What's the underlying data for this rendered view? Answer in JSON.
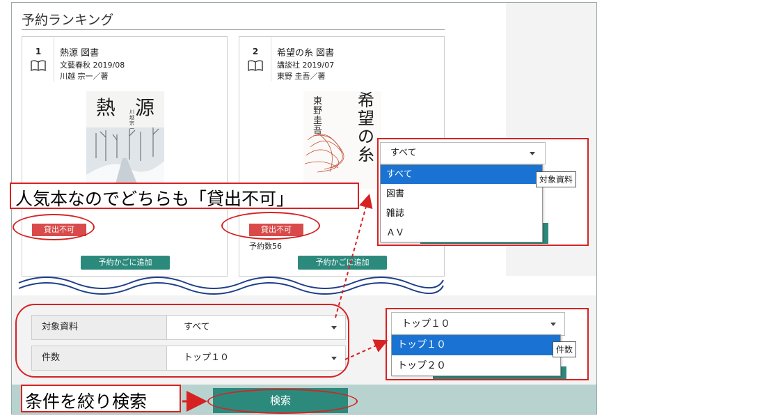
{
  "page": {
    "title": "予約ランキング"
  },
  "books": [
    {
      "rank": "1",
      "title": "熱源 図書",
      "publisher": "文藝春秋 2019/08",
      "author": "川越 宗一／著",
      "cover_title": "熱　源",
      "cover_author": "川越宗一",
      "status": "貸出不可",
      "reserve_count": "",
      "add_to_cart": "予約かごに追加"
    },
    {
      "rank": "2",
      "title": "希望の糸 図書",
      "publisher": "講談社 2019/07",
      "author": "東野 圭吾／著",
      "cover_title": "希望の糸",
      "cover_author": "東野圭吾",
      "status": "貸出不可",
      "reserve_count": "予約数56",
      "add_to_cart": "予約かごに追加"
    }
  ],
  "form": {
    "material": {
      "label": "対象資料",
      "value": "すべて"
    },
    "count": {
      "label": "件数",
      "value": "トップ１０"
    },
    "search_button": "検索"
  },
  "callouts": {
    "unavailable": "人気本なのでどちらも「貸出不可」",
    "search": "条件を絞り検索"
  },
  "dropdown_material": {
    "selected": "すべて",
    "options": [
      "すべて",
      "図書",
      "雑誌",
      "ＡＶ"
    ],
    "tooltip": "対象資料"
  },
  "dropdown_count": {
    "selected": "トップ１０",
    "options": [
      "トップ１０",
      "トップ２０"
    ],
    "tooltip": "件数"
  },
  "colors": {
    "accent_teal": "#2c8a7d",
    "annotation_red": "#d62222",
    "badge_red": "#d94b4b",
    "selected_blue": "#1a73d2"
  }
}
